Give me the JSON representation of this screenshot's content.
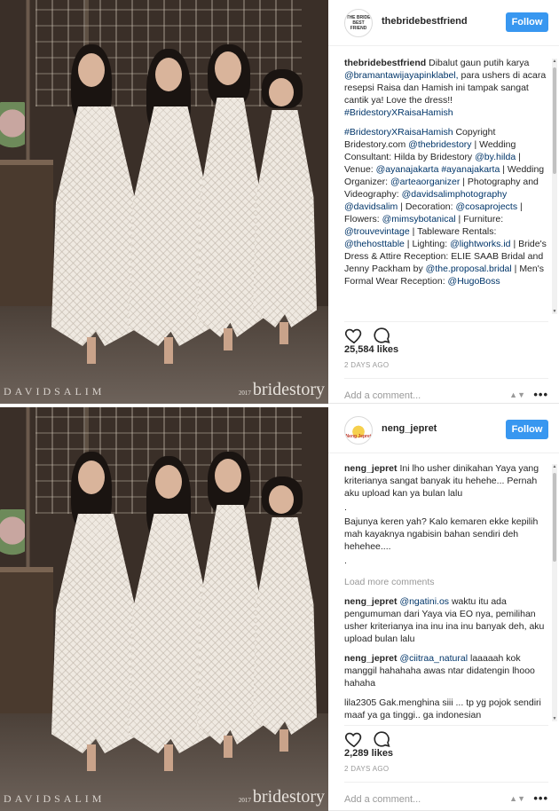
{
  "posts": [
    {
      "photo": {
        "watermark_left": "DAVIDSALIM",
        "watermark_year": "2017",
        "watermark_right": "bridestory"
      },
      "account": {
        "username": "thebridebestfriend",
        "avatar_text": "THE BRIDE BEST FRIEND"
      },
      "follow_label": "Follow",
      "comments": [
        {
          "user": "thebridebestfriend",
          "text": "Dibalut gaun putih karya @bramantawijayapinklabel, para ushers di acara resepsi Raisa dan Hamish ini tampak sangat cantik ya! Love the dress!! #BridestoryXRaisaHamish"
        },
        {
          "user": "",
          "text": "#BridestoryXRaisaHamish Copyright Bridestory.com @thebridestory | Wedding Consultant: Hilda by Bridestory @by.hilda | Venue: @ayanajakarta #ayanajakarta | Wedding Organizer: @arteaorganizer | Photography and Videography: @davidsalimphotography @davidsalim | Decoration: @cosaprojects | Flowers: @mimsybotanical | Furniture: @trouvevintage | Tableware Rentals: @thehosttable | Lighting: @lightworks.id | Bride's Dress & Attire Reception: ELIE SAAB Bridal and Jenny Packham by @the.proposal.bridal | Men's Formal Wear Reception: @HugoBoss"
        }
      ],
      "likes": "25,584 likes",
      "time": "2 DAYS AGO",
      "add_comment_placeholder": "Add a comment...",
      "more_label": "•••"
    },
    {
      "photo": {
        "watermark_left": "DAVIDSALIM",
        "watermark_year": "2017",
        "watermark_right": "bridestory"
      },
      "account": {
        "username": "neng_jepret",
        "avatar_text": "Neng Jepret"
      },
      "follow_label": "Follow",
      "comments": [
        {
          "user": "neng_jepret",
          "text": "Ini lho usher dinikahan Yaya yang kriterianya sangat banyak itu hehehe... Pernah aku upload kan ya bulan lalu"
        },
        {
          "user": "",
          "text": "."
        },
        {
          "user": "",
          "text": "Bajunya keren yah? Kalo kemaren ekke kepilih mah kayaknya ngabisin bahan sendiri deh hehehee...."
        },
        {
          "user": "",
          "text": "."
        }
      ],
      "load_more": "Load more comments",
      "replies": [
        {
          "user": "neng_jepret",
          "text": "@ngatini.os waktu itu ada pengumuman dari Yaya via EO nya, pemilihan usher kriterianya ina inu ina inu banyak deh, aku upload bulan lalu"
        },
        {
          "user": "neng_jepret",
          "text": "@ciitraa_natural laaaaah kok manggil hahahaha awas ntar didatengin lhooo hahaha"
        },
        {
          "user": "lila2305",
          "text": "Gak.menghina siii ... tp yg pojok sendiri maaf ya ga tinggi.. ga indonesian"
        }
      ],
      "likes": "2,289 likes",
      "time": "2 DAYS AGO",
      "add_comment_placeholder": "Add a comment...",
      "more_label": "•••"
    }
  ]
}
